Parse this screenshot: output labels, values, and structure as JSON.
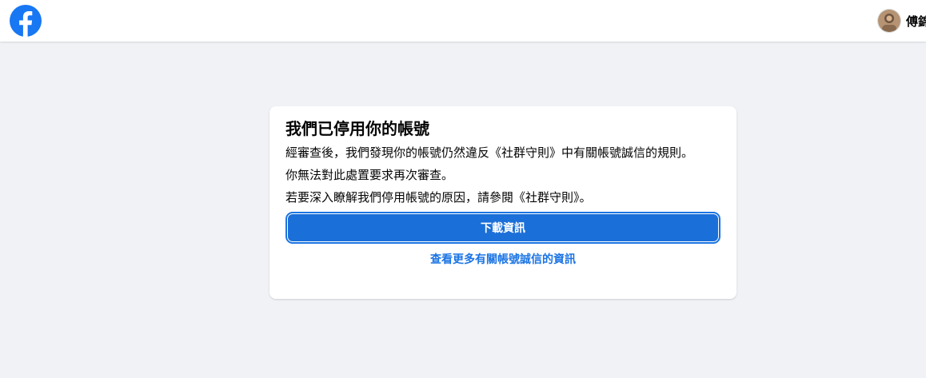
{
  "header": {
    "logo_icon": "facebook-logo-icon",
    "brand_color": "#1877f2",
    "profile_name": "傅錦"
  },
  "card": {
    "title": "我們已停用你的帳號",
    "paragraph_1": "經審查後，我們發現你的帳號仍然違反《社群守則》中有關帳號誠信的規則。",
    "paragraph_2": "你無法對此處置要求再次審查。",
    "paragraph_3": "若要深入瞭解我們停用帳號的原因，請參閱《社群守則》。",
    "download_button_label": "下載資訊",
    "learn_more_link": "查看更多有關帳號誠信的資訊"
  },
  "colors": {
    "page_background": "#f0f2f5",
    "button_blue": "#1b6fd8",
    "link_blue": "#1b74e4"
  }
}
